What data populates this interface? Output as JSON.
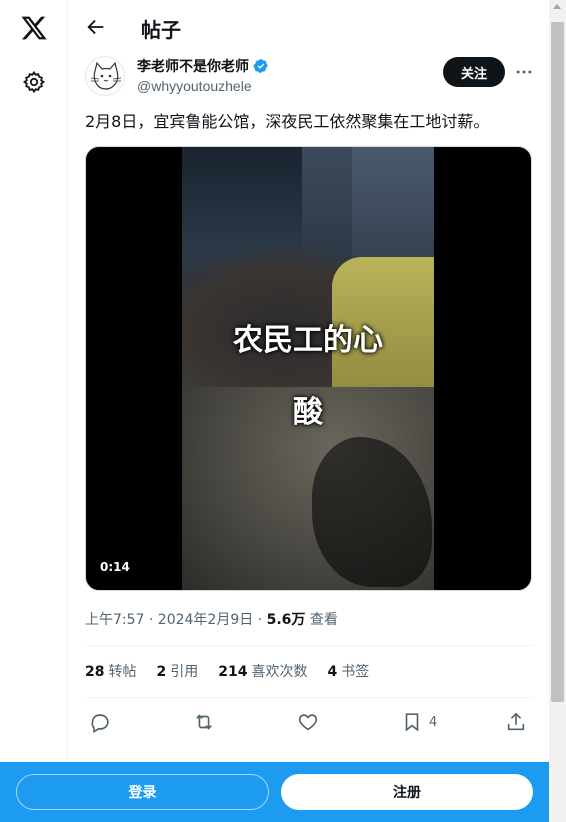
{
  "header": {
    "title": "帖子"
  },
  "author": {
    "name": "李老师不是你老师",
    "handle": "@whyyoutouzhele",
    "follow_label": "关注"
  },
  "tweet": {
    "text": "2月8日，宜宾鲁能公馆，深夜民工依然聚集在工地讨薪。",
    "video": {
      "caption_line1": "农民工的心",
      "caption_line2": "酸",
      "duration": "0:14"
    },
    "meta": {
      "time": "上午7:57 · 2024年2月9日 · ",
      "views": "5.6万",
      "views_label": " 查看"
    }
  },
  "stats": {
    "retweets": {
      "count": "28",
      "label": "转帖"
    },
    "quotes": {
      "count": "2",
      "label": "引用"
    },
    "likes": {
      "count": "214",
      "label": "喜欢次数"
    },
    "bookmarks": {
      "count": "4",
      "label": "书签"
    }
  },
  "actions": {
    "bookmark_count": "4"
  },
  "bottom_bar": {
    "login_label": "登录",
    "signup_label": "注册"
  },
  "colors": {
    "accent": "#1d9bf0",
    "text_primary": "#0f1419",
    "text_secondary": "#536471"
  },
  "icons": [
    "x-logo-icon",
    "gear-icon",
    "back-arrow-icon",
    "verified-badge-icon",
    "more-icon",
    "reply-icon",
    "retweet-icon",
    "like-icon",
    "bookmark-icon",
    "share-icon"
  ]
}
